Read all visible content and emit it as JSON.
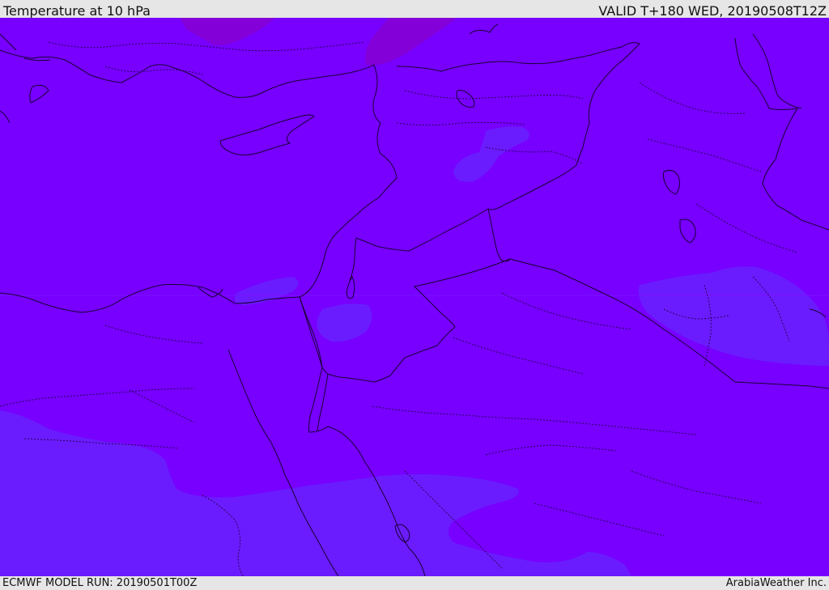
{
  "header": {
    "title": "Temperature at 10 hPa",
    "valid": "VALID T+180 WED, 20190508T12Z"
  },
  "footer": {
    "model_run": "ECMWF MODEL RUN: 20190501T00Z",
    "credit": "ArabiaWeather Inc."
  },
  "colors": {
    "base_field": "#7700ff",
    "cooler_field": "#6614ff",
    "warmer_field": "#8a00d4",
    "coastline": "#1a0033",
    "border": "#2a0052"
  }
}
